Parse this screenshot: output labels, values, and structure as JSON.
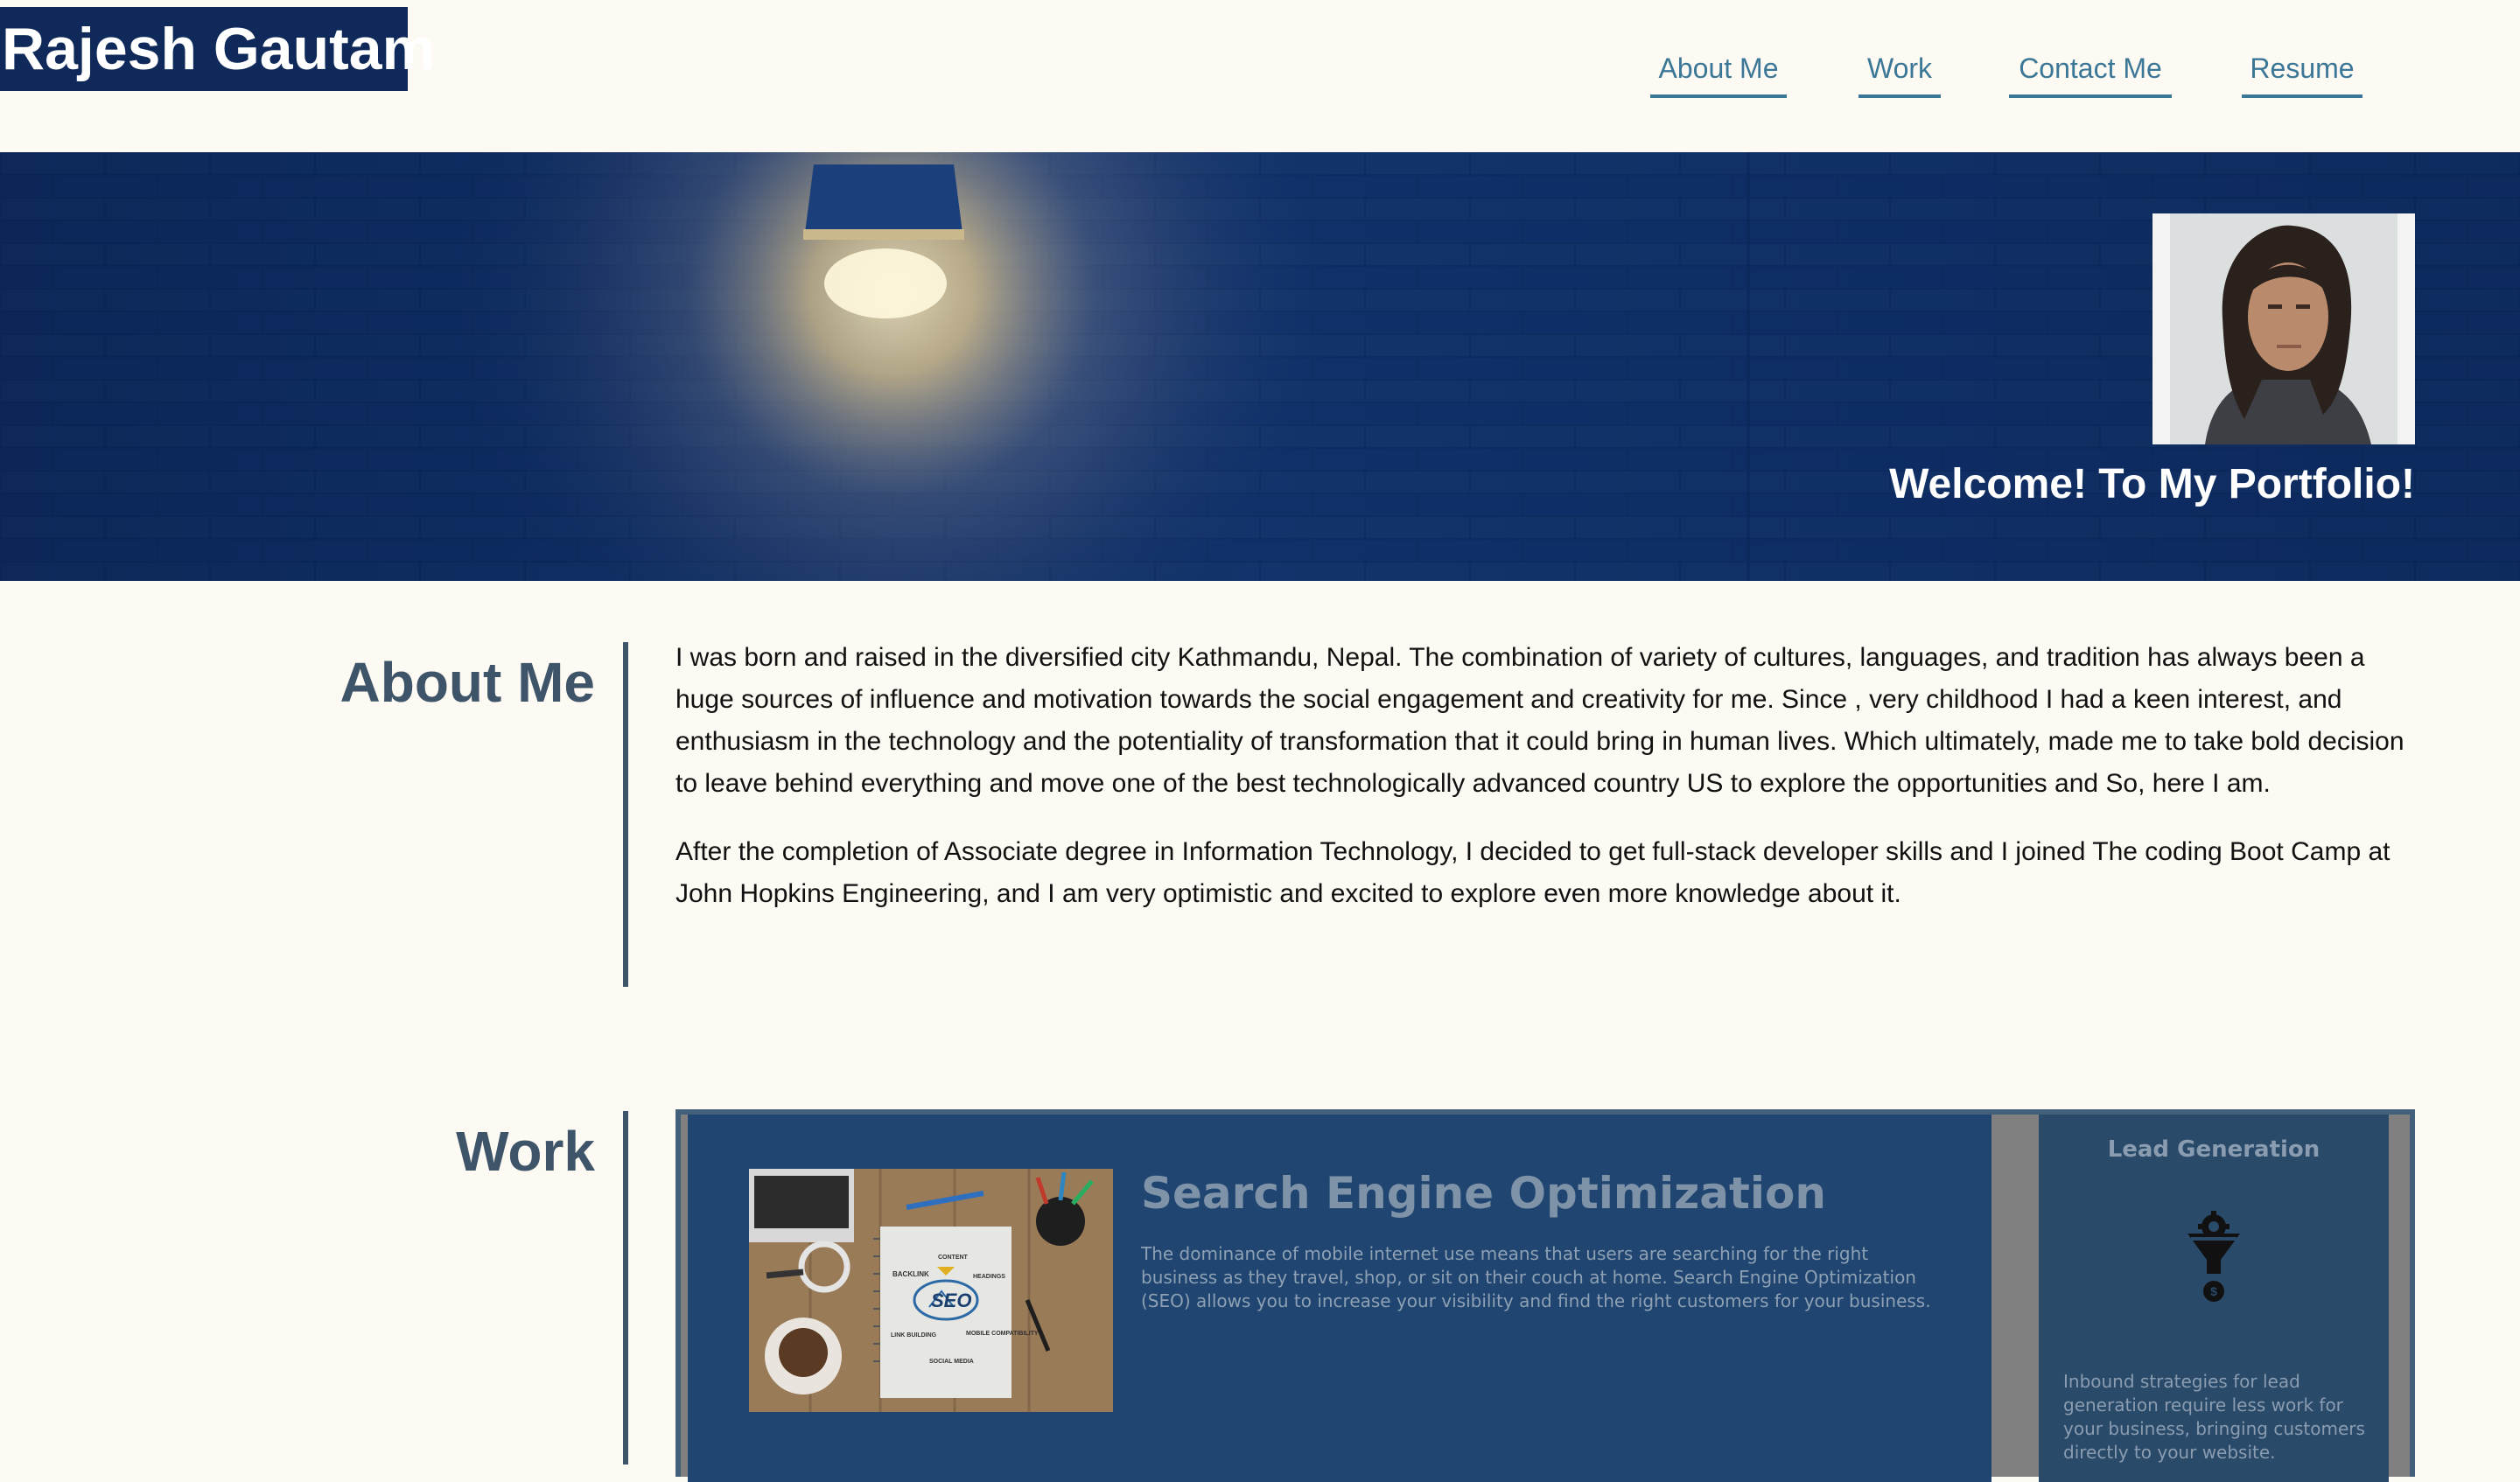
{
  "header": {
    "brand": "Rajesh Gautam",
    "nav": [
      "About Me",
      "Work",
      "Contact Me",
      "Resume"
    ]
  },
  "hero": {
    "title": "Welcome! To My Portfolio!"
  },
  "about": {
    "heading": "About Me",
    "paragraphs": [
      "I was born and raised in the diversified city Kathmandu, Nepal. The combination of variety of cultures, languages, and tradition has always been a huge sources of influence and motivation towards the social engagement and creativity for me. Since , very childhood I had a keen interest, and enthusiasm in the technology and the potentiality of transformation that it could bring in human lives. Which ultimately, made me to take bold decision to leave behind everything and move one of the best technologically advanced country US to explore the opportunities and So, here I am.",
      "After the completion of Associate degree in Information Technology, I decided to get full-stack developer skills and I joined The coding Boot Camp at John Hopkins Engineering, and I am very optimistic and excited to explore even more knowledge about it."
    ]
  },
  "work": {
    "heading": "Work",
    "seo": {
      "title": "Search Engine Optimization",
      "description": "The dominance of mobile internet use means that users are searching for the right business as they travel, shop, or sit on their couch at home. Search Engine Optimization (SEO) allows you to increase your visibility and find the right customers for your business.",
      "image_labels": [
        "CONTENT",
        "BACKLINK",
        "HEADINGS",
        "SEO",
        "LINK BUILDING",
        "MOBILE COMPATIBILITY",
        "SOCIAL MEDIA"
      ]
    },
    "lead": {
      "title": "Lead Generation",
      "description": "Inbound strategies for lead generation require less work for your business, bringing customers directly to your website.",
      "icon": "funnel-gear-icon",
      "icon_symbol": "$"
    }
  },
  "colors": {
    "page_bg": "#fdf9f3",
    "brand_bg": "#0f2a5a",
    "nav_link": "#3b7797",
    "heading": "#3e5468",
    "hero_wall": "#0d2d63",
    "card_bg": "#1f4570"
  }
}
